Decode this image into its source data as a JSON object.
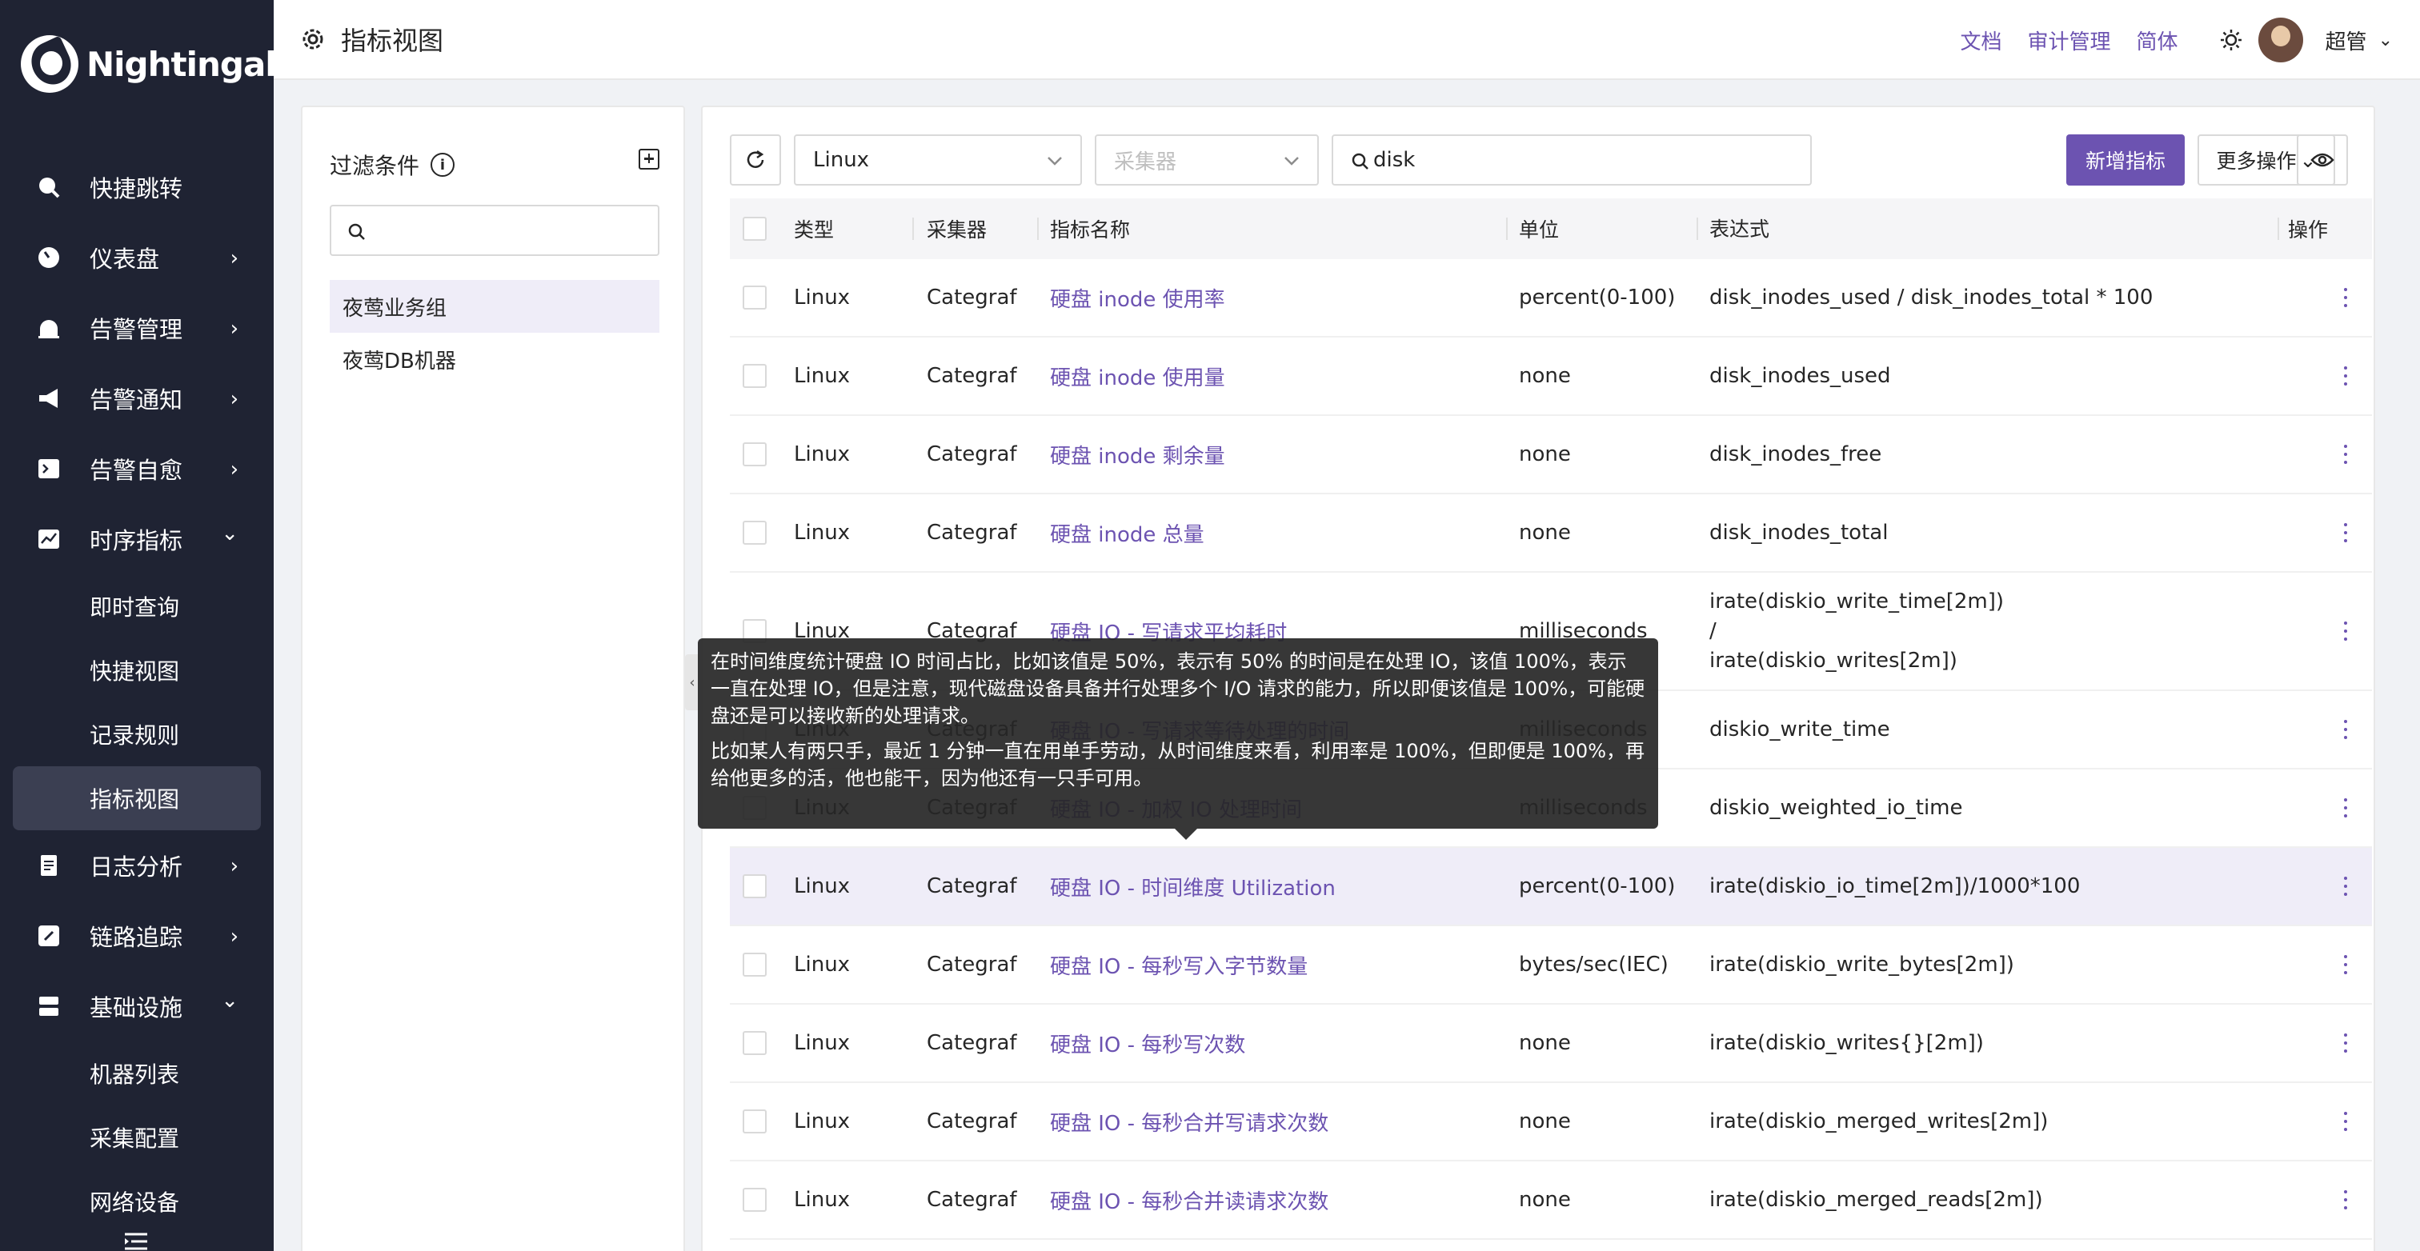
{
  "app": {
    "brand": "Nightingale"
  },
  "sidebar": {
    "items": [
      {
        "label": "快捷跳转",
        "icon": "search-icon",
        "chevron": ""
      },
      {
        "label": "仪表盘",
        "icon": "dashboard-icon",
        "chevron": "›"
      },
      {
        "label": "告警管理",
        "icon": "alarm-icon",
        "chevron": "›"
      },
      {
        "label": "告警通知",
        "icon": "megaphone-icon",
        "chevron": "›"
      },
      {
        "label": "告警自愈",
        "icon": "terminal-icon",
        "chevron": "›"
      },
      {
        "label": "时序指标",
        "icon": "chart-icon",
        "chevron": "⌄"
      }
    ],
    "metrics_sub": [
      "即时查询",
      "快捷视图",
      "记录规则",
      "指标视图"
    ],
    "items2": [
      {
        "label": "日志分析",
        "icon": "log-icon",
        "chevron": "›"
      },
      {
        "label": "链路追踪",
        "icon": "link-icon",
        "chevron": "›"
      },
      {
        "label": "基础设施",
        "icon": "server-icon",
        "chevron": "⌄"
      }
    ],
    "infra_sub": [
      "机器列表",
      "采集配置",
      "网络设备"
    ]
  },
  "header": {
    "title": "指标视图",
    "links": [
      "文档",
      "审计管理",
      "简体"
    ],
    "user": "超管"
  },
  "filter": {
    "title": "过滤条件",
    "groups": [
      "夜莺业务组",
      "夜莺DB机器"
    ]
  },
  "toolbar": {
    "os_value": "Linux",
    "collector_placeholder": "采集器",
    "search_value": "disk",
    "add_label": "新增指标",
    "more_label": "更多操作"
  },
  "table": {
    "headers": {
      "type": "类型",
      "collector": "采集器",
      "name": "指标名称",
      "unit": "单位",
      "expr": "表达式",
      "op": "操作"
    },
    "rows": [
      {
        "type": "Linux",
        "collector": "Categraf",
        "name": "硬盘 inode 使用率",
        "unit": "percent(0-100)",
        "expr": "disk_inodes_used / disk_inodes_total * 100"
      },
      {
        "type": "Linux",
        "collector": "Categraf",
        "name": "硬盘 inode 使用量",
        "unit": "none",
        "expr": "disk_inodes_used"
      },
      {
        "type": "Linux",
        "collector": "Categraf",
        "name": "硬盘 inode 剩余量",
        "unit": "none",
        "expr": "disk_inodes_free"
      },
      {
        "type": "Linux",
        "collector": "Categraf",
        "name": "硬盘 inode 总量",
        "unit": "none",
        "expr": "disk_inodes_total"
      },
      {
        "type": "Linux",
        "collector": "Categraf",
        "name": "硬盘 IO - 写请求平均耗时",
        "unit": "milliseconds",
        "expr": "irate(diskio_write_time[2m])",
        "expr2": "/",
        "expr3": "irate(diskio_writes[2m])"
      },
      {
        "type": "Linux",
        "collector": "Categraf",
        "name": "硬盘 IO - 写请求等待处理的时间",
        "unit": "milliseconds",
        "expr": "diskio_write_time"
      },
      {
        "type": "Linux",
        "collector": "Categraf",
        "name": "硬盘 IO - 加权 IO 处理时间",
        "unit": "milliseconds",
        "expr": "diskio_weighted_io_time"
      },
      {
        "type": "Linux",
        "collector": "Categraf",
        "name": "硬盘 IO - 时间维度 Utilization",
        "unit": "percent(0-100)",
        "expr": "irate(diskio_io_time[2m])/1000*100"
      },
      {
        "type": "Linux",
        "collector": "Categraf",
        "name": "硬盘 IO - 每秒写入字节数量",
        "unit": "bytes/sec(IEC)",
        "expr": "irate(diskio_write_bytes[2m])"
      },
      {
        "type": "Linux",
        "collector": "Categraf",
        "name": "硬盘 IO - 每秒写次数",
        "unit": "none",
        "expr": "irate(diskio_writes{}[2m])"
      },
      {
        "type": "Linux",
        "collector": "Categraf",
        "name": "硬盘 IO - 每秒合并写请求次数",
        "unit": "none",
        "expr": "irate(diskio_merged_writes[2m])"
      },
      {
        "type": "Linux",
        "collector": "Categraf",
        "name": "硬盘 IO - 每秒合并读请求次数",
        "unit": "none",
        "expr": "irate(diskio_merged_reads[2m])"
      }
    ]
  },
  "tooltip": {
    "p1": "在时间维度统计硬盘 IO 时间占比，比如该值是 50%，表示有 50% 的时间是在处理 IO，该值 100%，表示一直在处理 IO，但是注意，现代磁盘设备具备并行处理多个 I/O 请求的能力，所以即便该值是 100%，可能硬盘还是可以接收新的处理请求。",
    "p2": "比如某人有两只手，最近 1 分钟一直在用单手劳动，从时间维度来看，利用率是 100%，但即便是 100%，再给他更多的活，他也能干，因为他还有一只手可用。"
  },
  "colors": {
    "accent": "#6c53b1",
    "sidebar_bg": "#1f2333",
    "row_highlight": "#efedf8"
  }
}
